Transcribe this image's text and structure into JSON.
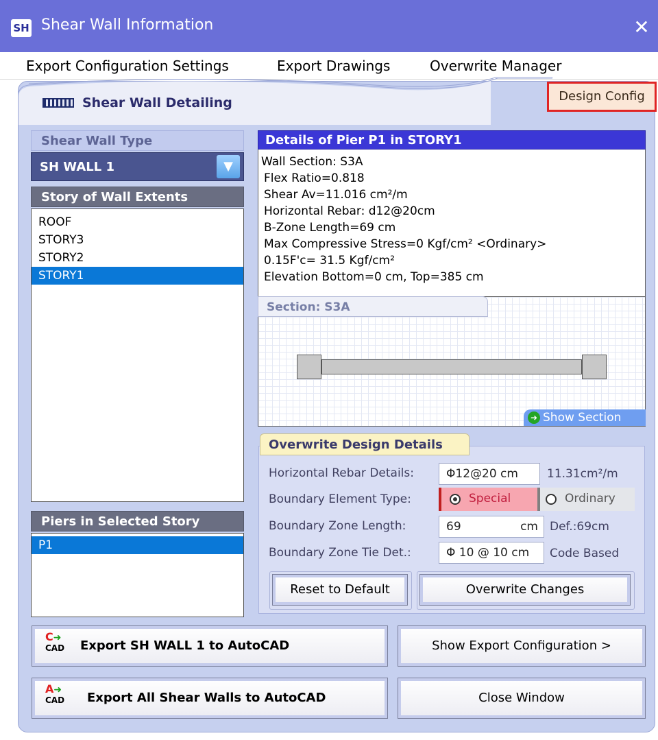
{
  "window": {
    "icon_text": "SH",
    "title": "Shear Wall Information",
    "close_glyph": "✕"
  },
  "menu": {
    "items": [
      "Export Configuration Settings",
      "Export Drawings",
      "Overwrite Manager"
    ]
  },
  "tab": {
    "label": "Shear Wall Detailing",
    "design_config_label": "Design Config"
  },
  "left": {
    "wall_type_header": "Shear Wall Type",
    "wall_type_value": "SH WALL 1",
    "story_header": "Story of Wall Extents",
    "stories": [
      "ROOF",
      "STORY3",
      "STORY2",
      "STORY1"
    ],
    "selected_story": "STORY1",
    "piers_header": "Piers in Selected Story",
    "piers": [
      "P1"
    ]
  },
  "details": {
    "header": "Details of Pier P1 in STORY1",
    "lines": [
      "Wall Section: S3A",
      "Flex Ratio=0.818",
      "Shear Av=11.016 cm²/m",
      "Horizontal Rebar: d12@20cm",
      "B-Zone Length=69 cm",
      "Max Compressive Stress=0 Kgf/cm²  <Ordinary>",
      "0.15F'c= 31.5 Kgf/cm²",
      "Elevation Bottom=0 cm,   Top=385 cm"
    ],
    "section_tab": "Section: S3A",
    "show_section": "Show Section"
  },
  "overwrite": {
    "header": "Overwrite Design Details",
    "horizontal_label": "Horizontal Rebar Details:",
    "horizontal_value": "Φ12@20  cm",
    "horizontal_unit": "11.31cm²/m",
    "boundary_type_label": "Boundary Element Type:",
    "radio_special": "Special",
    "radio_ordinary": "Ordinary",
    "zone_length_label": "Boundary  Zone Length:",
    "zone_length_value": "69",
    "zone_length_unit_inner": "cm",
    "zone_length_def": "Def.:69cm",
    "tie_label": "Boundary Zone Tie Det.:",
    "tie_value": "Φ 10 @ 10  cm",
    "tie_note": "Code Based",
    "reset_button": "Reset to Default",
    "overwrite_button": "Overwrite Changes"
  },
  "bottom": {
    "export_one": "Export  SH WALL 1  to AutoCAD",
    "export_all": "Export All Shear Walls to AutoCAD",
    "show_export": "Show Export Configuration >",
    "close_window": "Close Window",
    "icon_c": "C",
    "icon_a": "A",
    "icon_cad": "CAD"
  },
  "colors": {
    "title_bar": "#6a6fd8",
    "panel": "#c6d0ef",
    "selected_row": "#0a78d7",
    "details_header": "#3b37d6",
    "design_config_border": "#e02424"
  }
}
